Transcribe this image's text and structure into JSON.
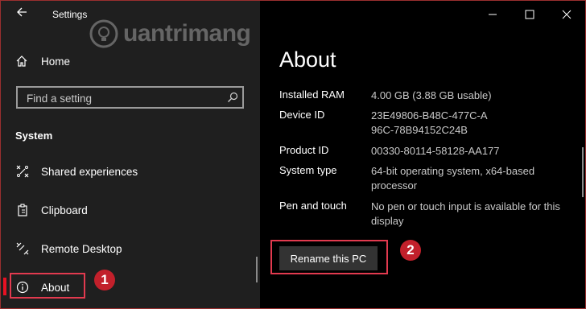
{
  "app": {
    "title": "Settings"
  },
  "watermark": {
    "text": "uantrimang"
  },
  "nav": {
    "home_label": "Home",
    "search_placeholder": "Find a setting",
    "section_heading": "System",
    "items": [
      {
        "label": "Shared experiences",
        "icon": "shared-experiences-icon"
      },
      {
        "label": "Clipboard",
        "icon": "clipboard-icon"
      },
      {
        "label": "Remote Desktop",
        "icon": "remote-desktop-icon"
      },
      {
        "label": "About",
        "icon": "info-icon",
        "selected": true
      }
    ]
  },
  "annotations": {
    "badge1": "1",
    "badge2": "2",
    "color": "#c2202b"
  },
  "main": {
    "title": "About",
    "specs": [
      {
        "key": "Installed RAM",
        "value": "4.00 GB (3.88 GB usable)"
      },
      {
        "key": "Device ID",
        "value": "23E49806-B48C-477C-A96C-78B94152C24B"
      },
      {
        "key": "Product ID",
        "value": "00330-80114-58128-AA177"
      },
      {
        "key": "System type",
        "value": "64-bit operating system, x64-based processor"
      },
      {
        "key": "Pen and touch",
        "value": "No pen or touch input is available for this display"
      }
    ],
    "rename_label": "Rename this PC"
  },
  "colors": {
    "accent": "#e81123",
    "highlight_box": "#e23a4f",
    "sidebar_bg": "#1f1f1f",
    "content_bg": "#000000"
  }
}
